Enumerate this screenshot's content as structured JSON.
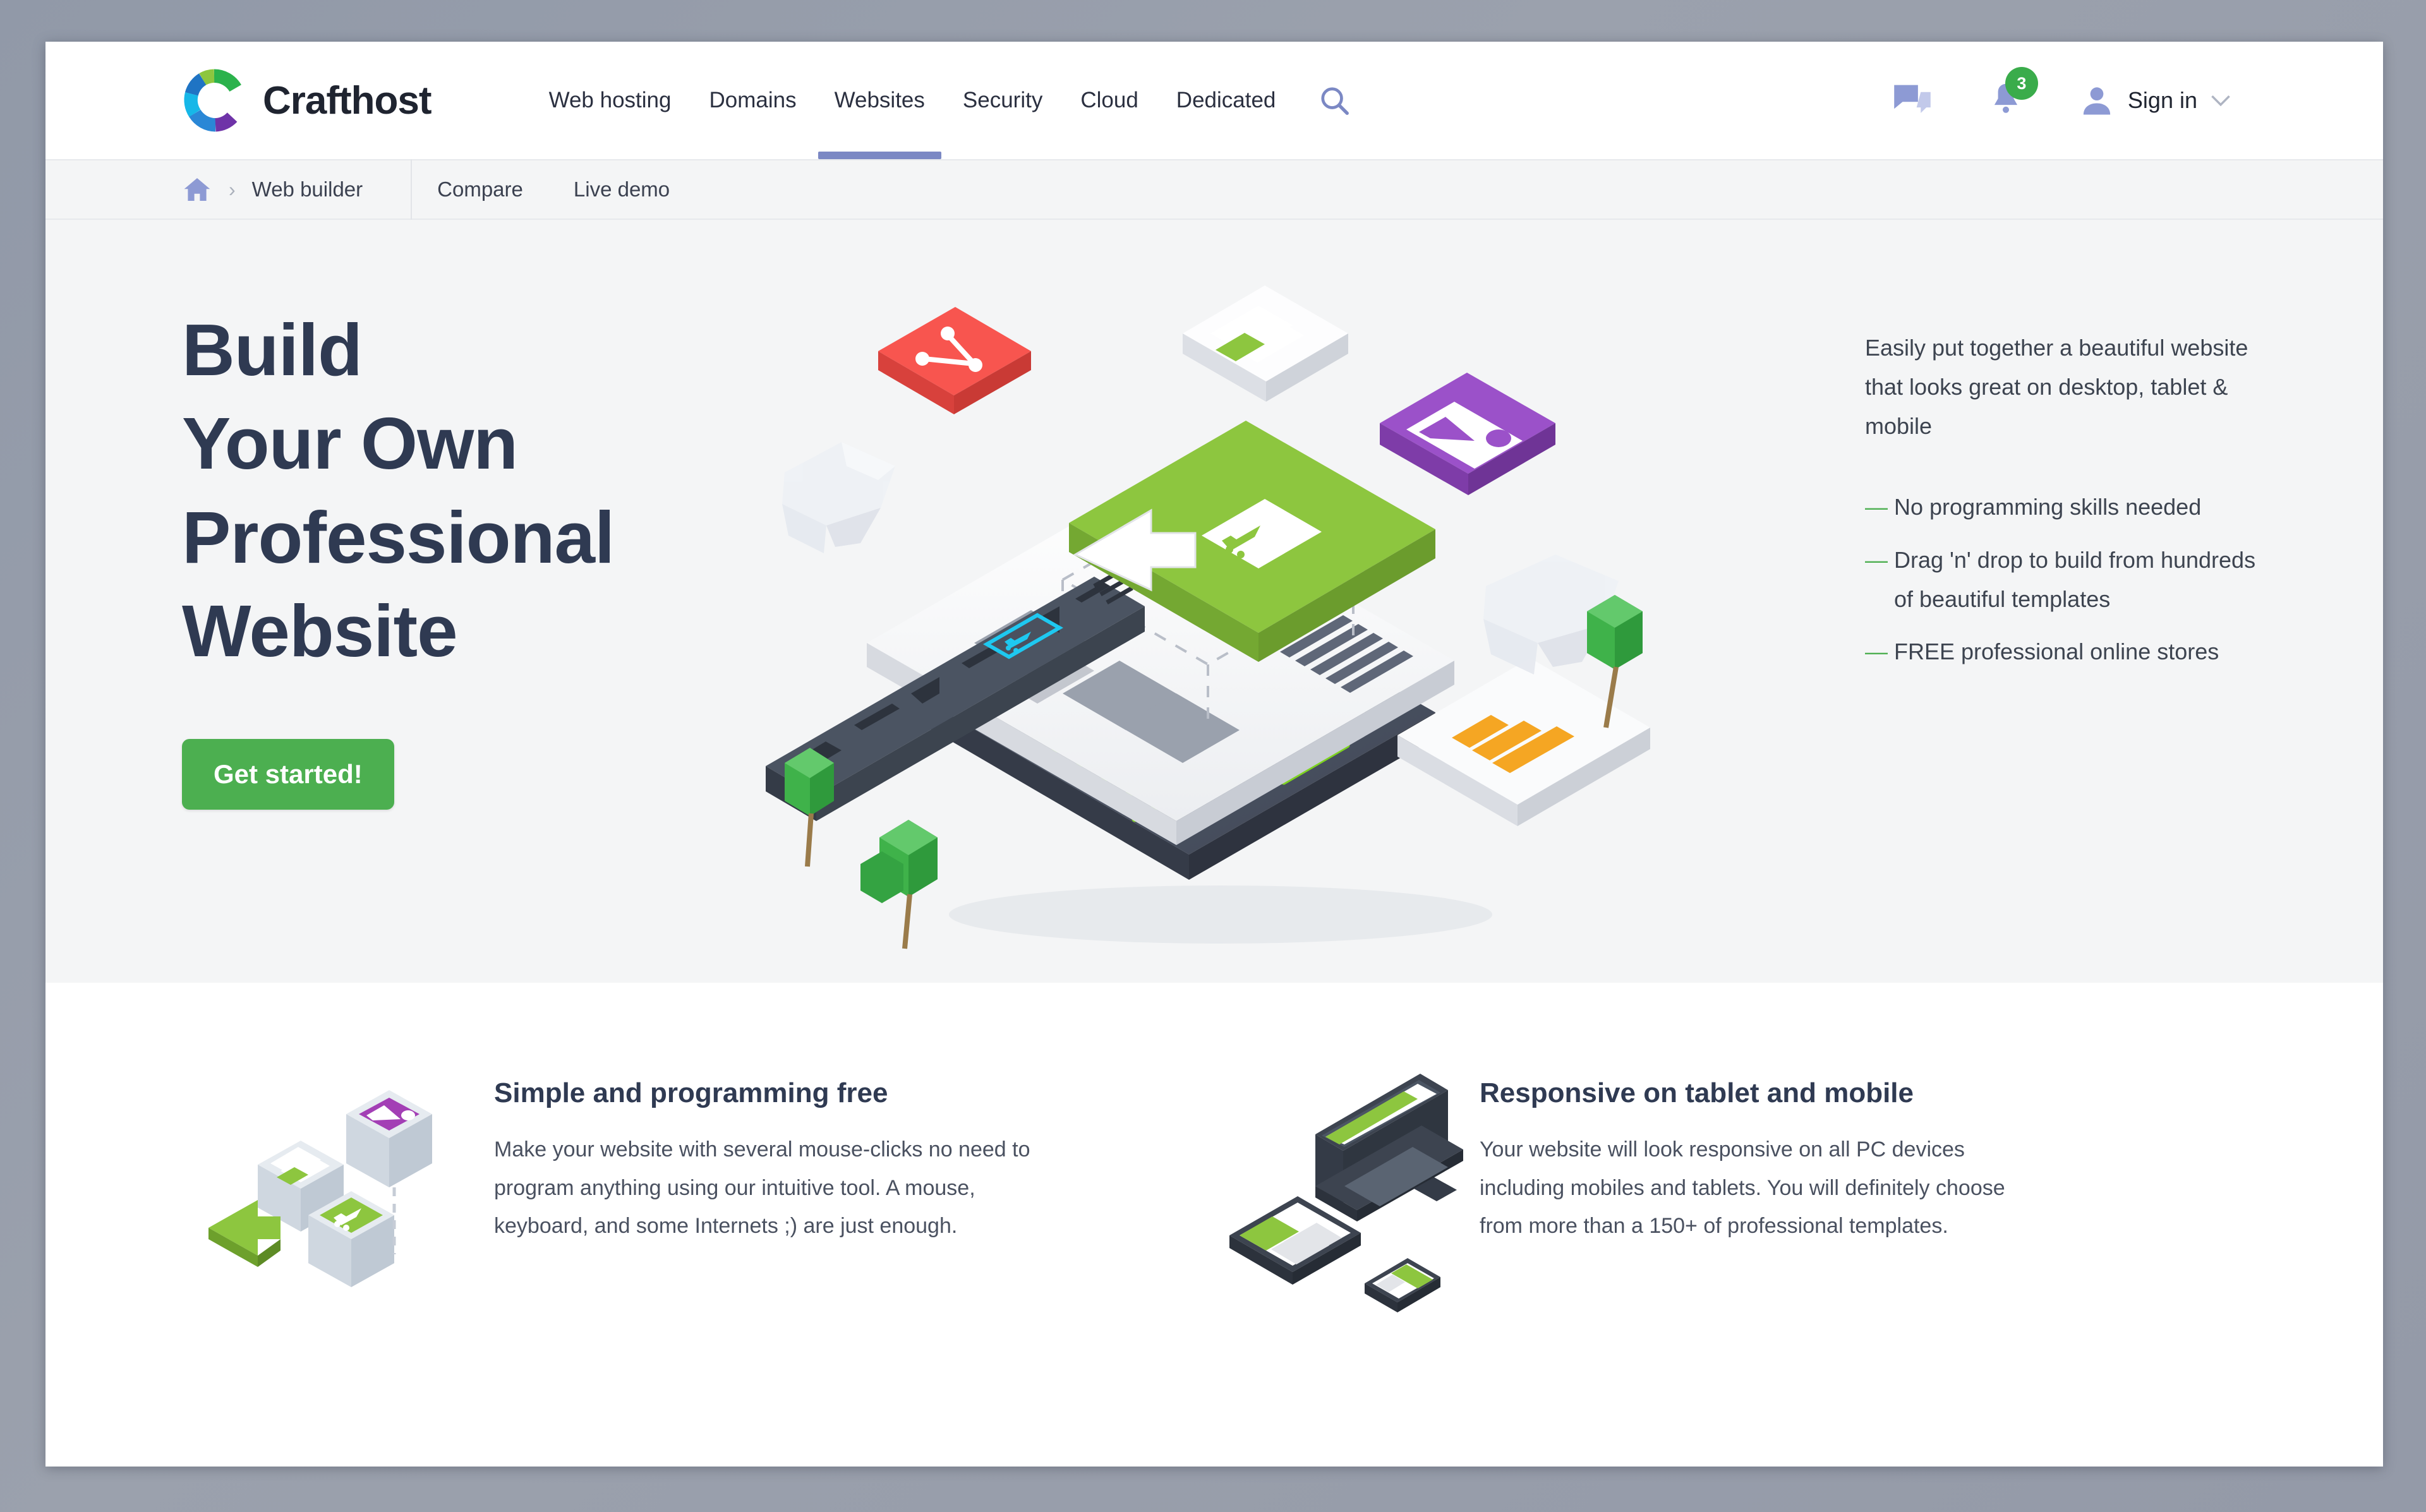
{
  "brand": {
    "name": "Crafthost",
    "logo_icon": "crafthost-ring-logo"
  },
  "nav": {
    "items": [
      {
        "label": "Web hosting",
        "active": false
      },
      {
        "label": "Domains",
        "active": false
      },
      {
        "label": "Websites",
        "active": true
      },
      {
        "label": "Security",
        "active": false
      },
      {
        "label": "Cloud",
        "active": false
      },
      {
        "label": "Dedicated",
        "active": false
      }
    ],
    "search_icon": "search-icon"
  },
  "header_actions": {
    "chat_icon": "chat-bubble-icon",
    "notifications_icon": "bell-icon",
    "notifications_count": "3",
    "account_icon": "user-avatar-icon",
    "signin_label": "Sign in",
    "chevron_icon": "chevron-down-icon"
  },
  "breadcrumb": {
    "home_icon": "home-icon",
    "separator": "›",
    "current": "Web builder"
  },
  "subnav": {
    "links": [
      "Compare",
      "Live demo"
    ]
  },
  "hero": {
    "title_lines": [
      "Build",
      "Your Own",
      "Professional",
      "Website"
    ],
    "cta_label": "Get started!",
    "intro": "Easily put together a beautiful website that looks great on desktop, tablet & mobile",
    "bullets": [
      "No programming skills needed",
      "Drag 'n' drop to build from hundreds of beautiful templates",
      "FREE professional online stores"
    ],
    "illustration": "isometric-website-builder-illustration"
  },
  "features": [
    {
      "icon": "isometric-blocks-icon",
      "title": "Simple and programming free",
      "text": "Make your website with several mouse-clicks no need to program anything using our intuitive tool. A mouse, keyboard, and some Internets ;) are just enough."
    },
    {
      "icon": "devices-laptop-tablet-phone-icon",
      "title": "Responsive on tablet and mobile",
      "text": "Your website will look responsive on all PC devices including mobiles and tablets. You will definitely choose from more than a 150+ of professional templates."
    }
  ],
  "colors": {
    "accent_green": "#4caf50",
    "active_tab": "#7b88c4",
    "heading": "#2f3a52",
    "hero_bg": "#f4f5f6",
    "page_bg": "#9aa0ac"
  }
}
